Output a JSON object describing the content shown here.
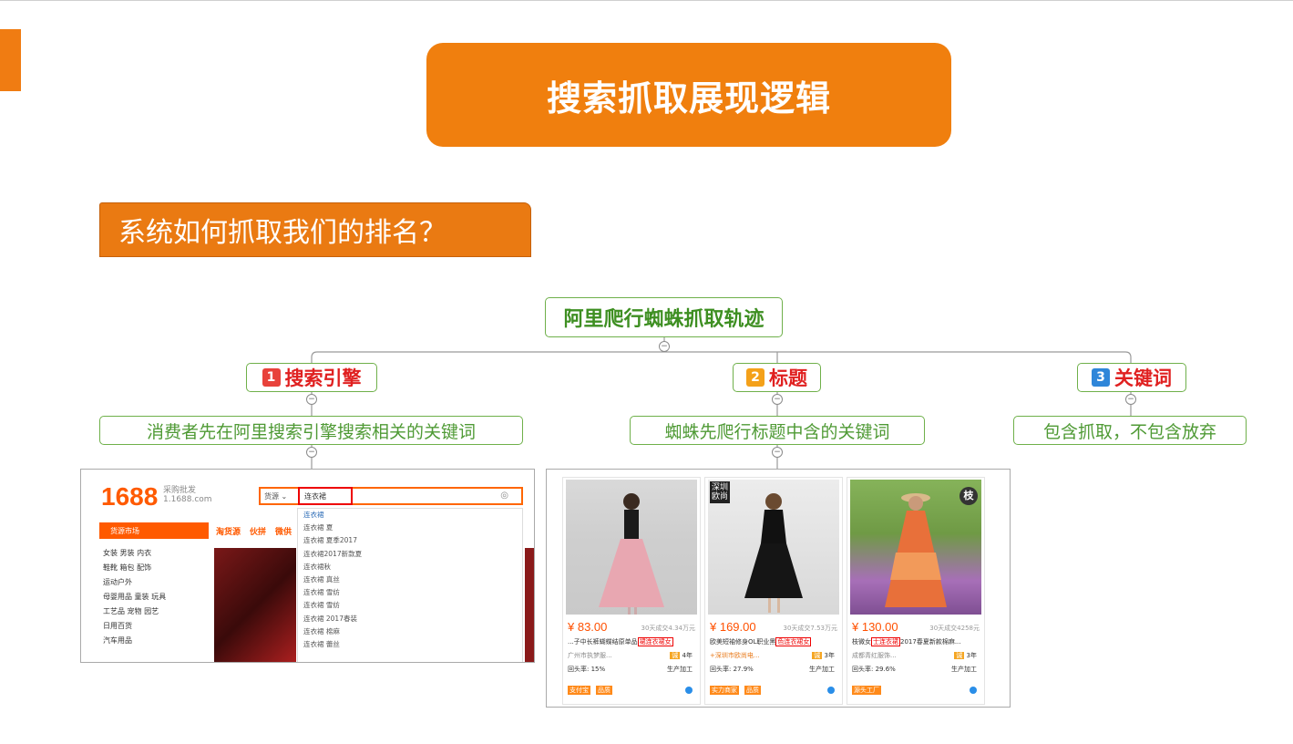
{
  "banner": {
    "title": "搜索抓取展现逻辑"
  },
  "question": {
    "text": "系统如何抓取我们的排名？"
  },
  "mindmap": {
    "root": "阿里爬行蜘蛛抓取轨迹",
    "branches": [
      {
        "num": "1",
        "label": "搜索引擎",
        "leaf": "消费者先在阿里搜索引擎搜索相关的关键词"
      },
      {
        "num": "2",
        "label": "标题",
        "leaf": "蜘蛛先爬行标题中含的关键词"
      },
      {
        "num": "3",
        "label": "关键词",
        "leaf": "包含抓取，不包含放弃"
      }
    ],
    "collapse_glyph": "⊖"
  },
  "site1688": {
    "logo": "1688",
    "logo_sub1": "采购批发",
    "logo_sub2": "1.1688.com",
    "search_select": "货源 ⌄",
    "search_value": "连衣裙",
    "category_header": "货源市场",
    "nav": [
      "淘货源",
      "伙拼",
      "微供"
    ],
    "categories": [
      "女装 男装 内衣",
      "鞋靴 箱包 配饰",
      "运动户外",
      "母婴用品 童装 玩具",
      "工艺品 宠物 园艺",
      "日用百货",
      "汽车用品"
    ],
    "suggestions": [
      "连衣裙",
      "连衣裙 夏",
      "连衣裙 夏季2017",
      "连衣裙2017新款夏",
      "连衣裙秋",
      "连衣裙 真丝",
      "连衣裙 雪纺",
      "连衣裙 雪纺",
      "连衣裙 2017春装",
      "连衣裙 棉麻",
      "连衣裙 蕾丝"
    ]
  },
  "products": [
    {
      "price": "¥ 83.00",
      "sold": "30天成交4.34万元",
      "title_pre": "...子中长裤蝴蝶结原单品",
      "title_hl": "裙连衣裙女",
      "shop": "广州市执梦服...",
      "years": "4年",
      "repeat": "回头率: 15%",
      "mfg": "生产加工",
      "tags": [
        "支付宝",
        "品质"
      ],
      "badge": ""
    },
    {
      "price": "¥ 169.00",
      "sold": "30天成交7.53万元",
      "title_pre": "欧美短袖修身OL职业黑",
      "title_hl": "色连衣裙女",
      "shop": "+深圳市欧尚电...",
      "years": "3年",
      "repeat": "回头率: 27.9%",
      "mfg": "生产加工",
      "tags": [
        "实力商家",
        "品质"
      ],
      "badge": "深圳\n欧尚"
    },
    {
      "price": "¥ 130.00",
      "sold": "30天成交4258元",
      "title_pre": "枝微女",
      "title_hl": "士连衣裙",
      "title_post": "2017春夏新款棉麻...",
      "shop": "成都青红服饰...",
      "years": "3年",
      "repeat": "回头率: 29.6%",
      "mfg": "生产加工",
      "tags": [
        "源头工厂"
      ],
      "badge": "枝"
    }
  ]
}
